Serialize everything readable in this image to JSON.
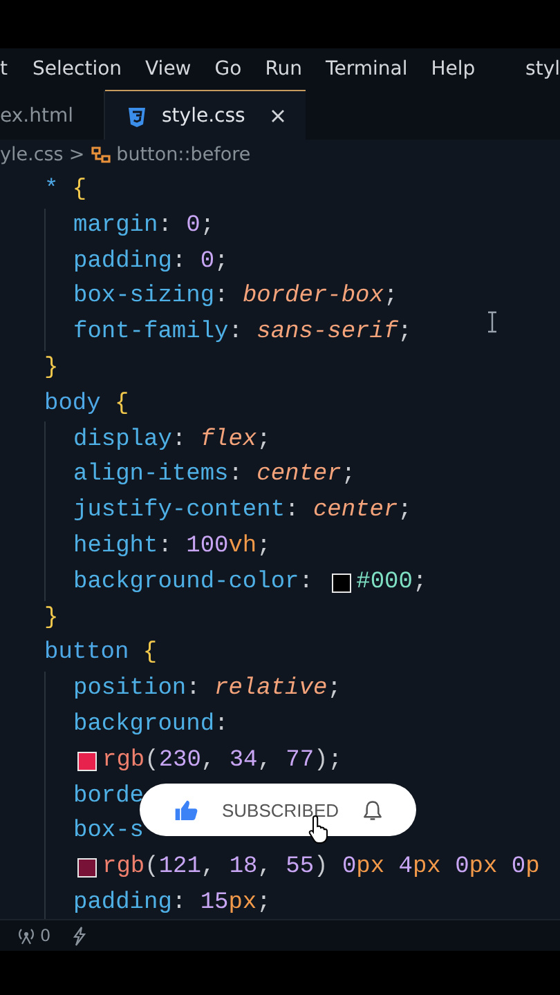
{
  "menu": {
    "items": [
      "t",
      "Selection",
      "View",
      "Go",
      "Run",
      "Terminal",
      "Help"
    ],
    "title": "styl"
  },
  "tabs": [
    {
      "label": "ex.html",
      "selected": false,
      "closable": false
    },
    {
      "label": "style.css",
      "selected": true,
      "closable": true
    }
  ],
  "breadcrumb": {
    "file": "yle.css",
    "separator": ">",
    "symbol": "button::before"
  },
  "code": {
    "lines": [
      {
        "tokens": [
          {
            "kind": "selector",
            "t": "*"
          },
          {
            "kind": "brace",
            "t": " {"
          }
        ],
        "children": [
          {
            "tokens": [
              {
                "kind": "property",
                "t": "margin"
              },
              {
                "kind": "punct",
                "t": ": "
              },
              {
                "kind": "number",
                "t": "0"
              },
              {
                "kind": "punct",
                "t": ";"
              }
            ]
          },
          {
            "tokens": [
              {
                "kind": "property",
                "t": "padding"
              },
              {
                "kind": "punct",
                "t": ": "
              },
              {
                "kind": "number",
                "t": "0"
              },
              {
                "kind": "punct",
                "t": ";"
              }
            ]
          },
          {
            "tokens": [
              {
                "kind": "property",
                "t": "box-sizing"
              },
              {
                "kind": "punct",
                "t": ": "
              },
              {
                "kind": "value",
                "t": "border-box"
              },
              {
                "kind": "punct",
                "t": ";"
              }
            ]
          },
          {
            "tokens": [
              {
                "kind": "property",
                "t": "font-family"
              },
              {
                "kind": "punct",
                "t": ": "
              },
              {
                "kind": "value",
                "t": "sans-serif"
              },
              {
                "kind": "punct",
                "t": ";"
              }
            ]
          }
        ]
      },
      {
        "tokens": [
          {
            "kind": "brace",
            "t": "}"
          }
        ]
      },
      {
        "tokens": [
          {
            "kind": "selector",
            "t": "body"
          },
          {
            "kind": "brace",
            "t": " {"
          }
        ],
        "children": [
          {
            "tokens": [
              {
                "kind": "property",
                "t": "display"
              },
              {
                "kind": "punct",
                "t": ": "
              },
              {
                "kind": "value",
                "t": "flex"
              },
              {
                "kind": "punct",
                "t": ";"
              }
            ]
          },
          {
            "tokens": [
              {
                "kind": "property",
                "t": "align-items"
              },
              {
                "kind": "punct",
                "t": ": "
              },
              {
                "kind": "value",
                "t": "center"
              },
              {
                "kind": "punct",
                "t": ";"
              }
            ]
          },
          {
            "tokens": [
              {
                "kind": "property",
                "t": "justify-content"
              },
              {
                "kind": "punct",
                "t": ": "
              },
              {
                "kind": "value",
                "t": "center"
              },
              {
                "kind": "punct",
                "t": ";"
              }
            ]
          },
          {
            "tokens": [
              {
                "kind": "property",
                "t": "height"
              },
              {
                "kind": "punct",
                "t": ": "
              },
              {
                "kind": "number",
                "t": "100"
              },
              {
                "kind": "unit",
                "t": "vh"
              },
              {
                "kind": "punct",
                "t": ";"
              }
            ]
          },
          {
            "tokens": [
              {
                "kind": "property",
                "t": "background-color"
              },
              {
                "kind": "punct",
                "t": ": "
              },
              {
                "kind": "swatch",
                "color": "#000000"
              },
              {
                "kind": "hex",
                "t": "#000"
              },
              {
                "kind": "punct",
                "t": ";"
              }
            ]
          }
        ]
      },
      {
        "tokens": [
          {
            "kind": "brace",
            "t": "}"
          }
        ]
      },
      {
        "tokens": [
          {
            "kind": "selector",
            "t": "button"
          },
          {
            "kind": "brace",
            "t": " {"
          }
        ],
        "children": [
          {
            "tokens": [
              {
                "kind": "property",
                "t": "position"
              },
              {
                "kind": "punct",
                "t": ": "
              },
              {
                "kind": "value",
                "t": "relative"
              },
              {
                "kind": "punct",
                "t": ";"
              }
            ]
          },
          {
            "tokens": [
              {
                "kind": "property",
                "t": "background"
              },
              {
                "kind": "punct",
                "t": ":"
              }
            ]
          },
          {
            "tokens": [
              {
                "kind": "swatch",
                "color": "#e6224d"
              },
              {
                "kind": "func",
                "t": "rgb"
              },
              {
                "kind": "punct",
                "t": "("
              },
              {
                "kind": "number",
                "t": "230"
              },
              {
                "kind": "punct",
                "t": ", "
              },
              {
                "kind": "number",
                "t": "34"
              },
              {
                "kind": "punct",
                "t": ", "
              },
              {
                "kind": "number",
                "t": "77"
              },
              {
                "kind": "punct",
                "t": ");"
              }
            ]
          },
          {
            "tokens": [
              {
                "kind": "property",
                "t": "borde"
              }
            ]
          },
          {
            "tokens": [
              {
                "kind": "property",
                "t": "box-s"
              }
            ]
          },
          {
            "tokens": [
              {
                "kind": "swatch",
                "color": "#791237"
              },
              {
                "kind": "func",
                "t": "rgb"
              },
              {
                "kind": "punct",
                "t": "("
              },
              {
                "kind": "number",
                "t": "121"
              },
              {
                "kind": "punct",
                "t": ", "
              },
              {
                "kind": "number",
                "t": "18"
              },
              {
                "kind": "punct",
                "t": ", "
              },
              {
                "kind": "number",
                "t": "55"
              },
              {
                "kind": "punct",
                "t": ") "
              },
              {
                "kind": "number",
                "t": "0"
              },
              {
                "kind": "unit",
                "t": "px"
              },
              {
                "kind": "number",
                "t": " 4"
              },
              {
                "kind": "unit",
                "t": "px"
              },
              {
                "kind": "number",
                "t": " 0"
              },
              {
                "kind": "unit",
                "t": "px"
              },
              {
                "kind": "number",
                "t": " 0"
              },
              {
                "kind": "unit",
                "t": "p"
              }
            ]
          },
          {
            "tokens": [
              {
                "kind": "property",
                "t": "padding"
              },
              {
                "kind": "punct",
                "t": ": "
              },
              {
                "kind": "number",
                "t": "15"
              },
              {
                "kind": "unit",
                "t": "px"
              },
              {
                "kind": "punct",
                "t": ";"
              }
            ]
          }
        ]
      }
    ]
  },
  "subscribe_button": {
    "label": "SUBSCRIBED"
  },
  "status_bar": {
    "ports": "0"
  }
}
